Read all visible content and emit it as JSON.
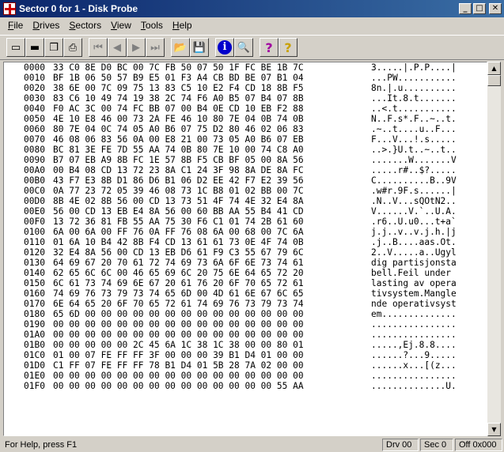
{
  "window": {
    "title": "Sector 0 for 1 - Disk Probe"
  },
  "menu": [
    {
      "label": "File",
      "key": "F",
      "rest": "ile"
    },
    {
      "label": "Drives",
      "key": "D",
      "rest": "rives"
    },
    {
      "label": "Sectors",
      "key": "S",
      "rest": "ectors"
    },
    {
      "label": "View",
      "key": "V",
      "rest": "iew"
    },
    {
      "label": "Tools",
      "key": "T",
      "rest": "ools"
    },
    {
      "label": "Help",
      "key": "H",
      "rest": "elp"
    }
  ],
  "rows": [
    [
      "0000",
      "33 C0 8E D0 BC 00 7C FB 50 07 50 1F FC BE 1B 7C",
      "3.....|.P.P....|"
    ],
    [
      "0010",
      "BF 1B 06 50 57 B9 E5 01 F3 A4 CB BD BE 07 B1 04",
      "...PW..........."
    ],
    [
      "0020",
      "38 6E 00 7C 09 75 13 83 C5 10 E2 F4 CD 18 8B F5",
      "8n.|.u.........."
    ],
    [
      "0030",
      "83 C6 10 49 74 19 38 2C 74 F6 A0 B5 07 B4 07 8B",
      "...It.8.t......."
    ],
    [
      "0040",
      "F0 AC 3C 00 74 FC BB 07 00 B4 0E CD 10 EB F2 88",
      "..<.t..........."
    ],
    [
      "0050",
      "4E 10 E8 46 00 73 2A FE 46 10 80 7E 04 0B 74 0B",
      "N..F.s*.F..~..t."
    ],
    [
      "0060",
      "80 7E 04 0C 74 05 A0 B6 07 75 D2 80 46 02 06 83",
      ".~..t....u..F..."
    ],
    [
      "0070",
      "46 08 06 83 56 0A 00 E8 21 00 73 05 A0 B6 07 EB",
      "F...V...!.s....."
    ],
    [
      "0080",
      "BC 81 3E FE 7D 55 AA 74 0B 80 7E 10 00 74 C8 A0",
      "..>.}U.t..~..t.."
    ],
    [
      "0090",
      "B7 07 EB A9 8B FC 1E 57 8B F5 CB BF 05 00 8A 56",
      ".......W.......V"
    ],
    [
      "00A0",
      "00 B4 08 CD 13 72 23 8A C1 24 3F 98 8A DE 8A FC",
      ".....r#..$?....."
    ],
    [
      "00B0",
      "43 F7 E3 8B D1 86 D6 B1 06 D2 EE 42 F7 E2 39 56",
      "C..........B..9V"
    ],
    [
      "00C0",
      "0A 77 23 72 05 39 46 08 73 1C B8 01 02 BB 00 7C",
      ".w#r.9F.s......|"
    ],
    [
      "00D0",
      "8B 4E 02 8B 56 00 CD 13 73 51 4F 74 4E 32 E4 8A",
      ".N..V...sQOtN2.."
    ],
    [
      "00E0",
      "56 00 CD 13 EB E4 8A 56 00 60 BB AA 55 B4 41 CD",
      "V......V.`..U.A."
    ],
    [
      "00F0",
      "13 72 36 81 FB 55 AA 75 30 F6 C1 01 74 2B 61 60",
      ".r6..U.u0...t+a`"
    ],
    [
      "0100",
      "6A 00 6A 00 FF 76 0A FF 76 08 6A 00 68 00 7C 6A",
      "j.j..v..v.j.h.|j"
    ],
    [
      "0110",
      "01 6A 10 B4 42 8B F4 CD 13 61 61 73 0E 4F 74 0B",
      ".j..B....aas.Ot."
    ],
    [
      "0120",
      "32 E4 8A 56 00 CD 13 EB D6 61 F9 C3 55 67 79 6C",
      "2..V.....a..Ugyl"
    ],
    [
      "0130",
      "64 69 67 20 70 61 72 74 69 73 6A 6F 6E 73 74 61",
      "dig partisjonsta"
    ],
    [
      "0140",
      "62 65 6C 6C 00 46 65 69 6C 20 75 6E 64 65 72 20",
      "bell.Feil under "
    ],
    [
      "0150",
      "6C 61 73 74 69 6E 67 20 61 76 20 6F 70 65 72 61",
      "lasting av opera"
    ],
    [
      "0160",
      "74 69 76 73 79 73 74 65 6D 00 4D 61 6E 67 6C 65",
      "tivsystem.Mangle"
    ],
    [
      "0170",
      "6E 64 65 20 6F 70 65 72 61 74 69 76 73 79 73 74",
      "nde operativsyst"
    ],
    [
      "0180",
      "65 6D 00 00 00 00 00 00 00 00 00 00 00 00 00 00",
      "em.............."
    ],
    [
      "0190",
      "00 00 00 00 00 00 00 00 00 00 00 00 00 00 00 00",
      "................"
    ],
    [
      "01A0",
      "00 00 00 00 00 00 00 00 00 00 00 00 00 00 00 00",
      "................"
    ],
    [
      "01B0",
      "00 00 00 00 00 2C 45 6A 1C 38 1C 38 00 00 80 01",
      ".....,Ej.8.8...."
    ],
    [
      "01C0",
      "01 00 07 FE FF FF 3F 00 00 00 39 B1 D4 01 00 00",
      "......?...9....."
    ],
    [
      "01D0",
      "C1 FF 07 FE FF FF 78 B1 D4 01 5B 28 7A 02 00 00",
      "......x...[(z..."
    ],
    [
      "01E0",
      "00 00 00 00 00 00 00 00 00 00 00 00 00 00 00 00",
      "................"
    ],
    [
      "01F0",
      "00 00 00 00 00 00 00 00 00 00 00 00 00 00 55 AA",
      "..............U."
    ]
  ],
  "status": {
    "help": "For Help, press F1",
    "drive": "Drv  00",
    "sector": "Sec 0",
    "offset": "Off 0x000"
  }
}
